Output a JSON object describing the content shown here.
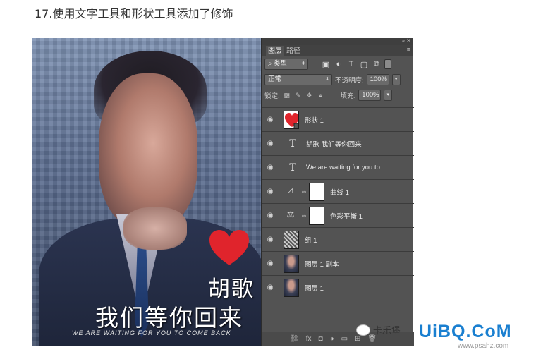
{
  "step_title": "17.使用文字工具和形状工具添加了修饰",
  "poster": {
    "name": "胡歌",
    "line": "我们等你回来",
    "english": "WE ARE WAITING FOR YOU TO COME BACK"
  },
  "panel": {
    "collapse_icon": "»",
    "close_icon": "✕",
    "menu_icon": "≡",
    "tabs": [
      {
        "label": "图层",
        "active": true
      },
      {
        "label": "路径",
        "active": false
      }
    ],
    "filter": {
      "kind_value": "类型"
    },
    "blend": {
      "mode": "正常",
      "opacity_label": "不透明度:",
      "opacity_value": "100%"
    },
    "lock": {
      "label": "锁定:",
      "fill_label": "填充:",
      "fill_value": "100%"
    },
    "layers": [
      {
        "name": "形状 1",
        "kind": "shape"
      },
      {
        "name": "胡歌 我们等你回来",
        "kind": "text"
      },
      {
        "name": "We are waiting for you to...",
        "kind": "text"
      },
      {
        "name": "曲线 1",
        "kind": "curves"
      },
      {
        "name": "色彩平衡 1",
        "kind": "balance"
      },
      {
        "name": "组 1",
        "kind": "group"
      },
      {
        "name": "图层 1 副本",
        "kind": "photo"
      },
      {
        "name": "图层 1",
        "kind": "photo"
      }
    ]
  },
  "watermark": {
    "text": "卡乐堡",
    "site": "UiBQ.CoM",
    "url": "www.psahz.com"
  },
  "colors": {
    "heart": "#e0242c",
    "site_logo": "#1a7fd0",
    "panel_bg": "#535353"
  }
}
